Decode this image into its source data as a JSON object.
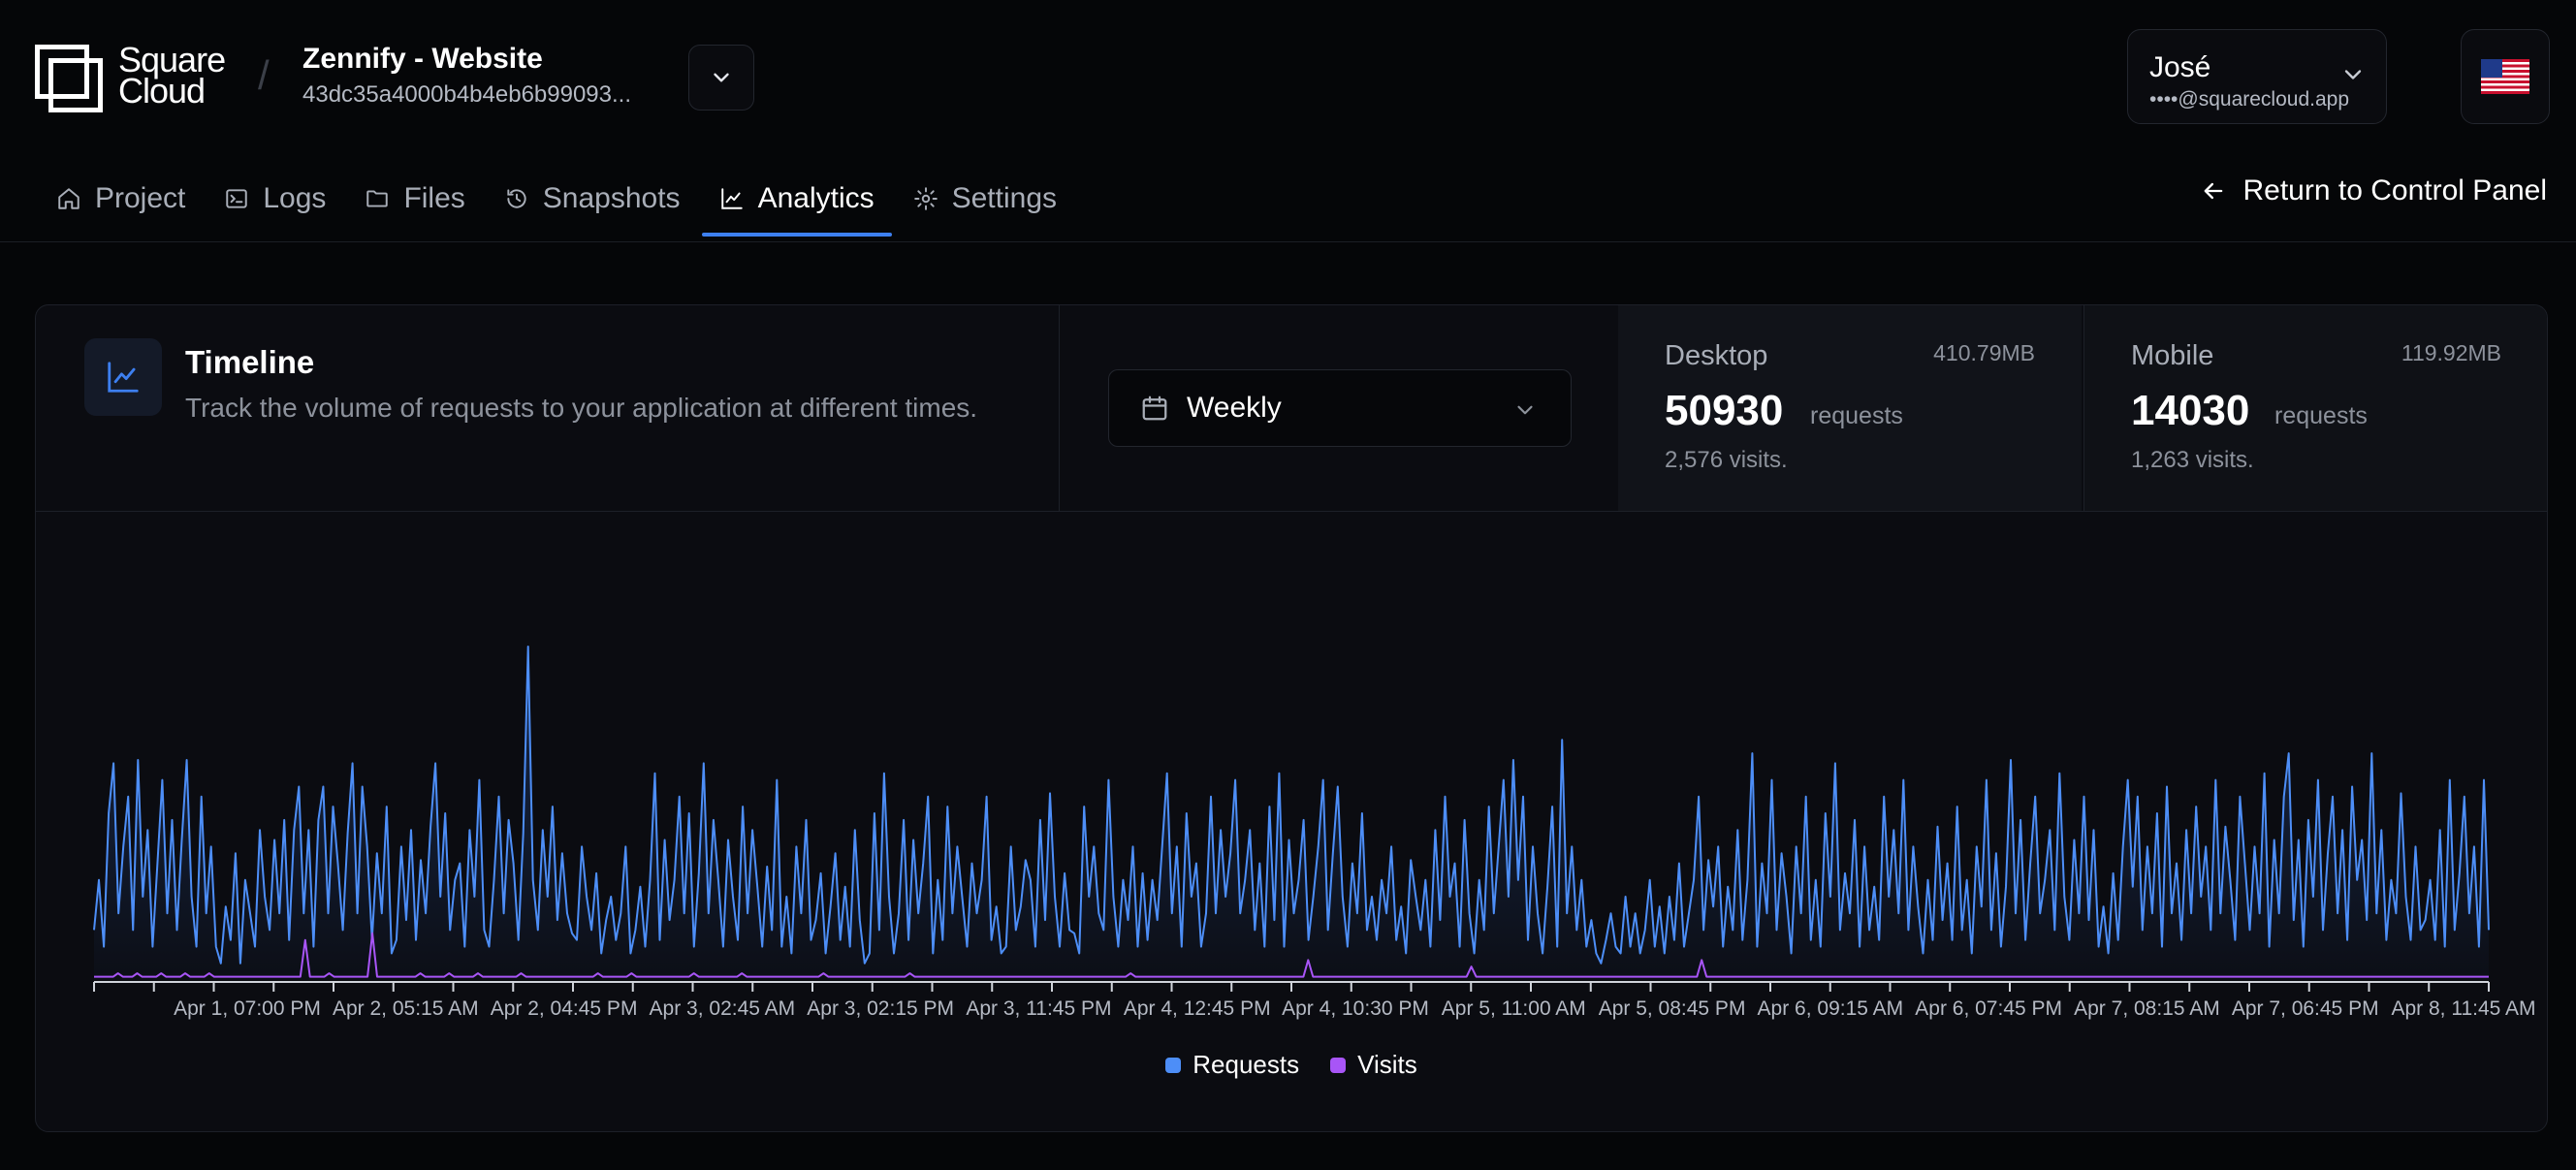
{
  "header": {
    "brand": {
      "line1": "Square",
      "line2": "Cloud"
    },
    "project": {
      "name": "Zennify - Website",
      "id": "43dc35a4000b4b4eb6b99093..."
    },
    "user": {
      "name": "José",
      "email": "••••@squarecloud.app"
    },
    "flag_icon": "us-flag-icon"
  },
  "tabs": [
    {
      "label": "Project",
      "icon": "home-icon",
      "active": false
    },
    {
      "label": "Logs",
      "icon": "terminal-icon",
      "active": false
    },
    {
      "label": "Files",
      "icon": "folder-icon",
      "active": false
    },
    {
      "label": "Snapshots",
      "icon": "history-icon",
      "active": false
    },
    {
      "label": "Analytics",
      "icon": "chart-line-icon",
      "active": true
    },
    {
      "label": "Settings",
      "icon": "gear-icon",
      "active": false
    }
  ],
  "return_label": "Return to Control Panel",
  "timeline": {
    "title": "Timeline",
    "description": "Track the volume of requests to your application at different times.",
    "period": "Weekly"
  },
  "stats": {
    "desktop": {
      "label": "Desktop",
      "size": "410.79MB",
      "requests": "50930",
      "unit": "requests",
      "visits": "2,576 visits."
    },
    "mobile": {
      "label": "Mobile",
      "size": "119.92MB",
      "requests": "14030",
      "unit": "requests",
      "visits": "1,263 visits."
    }
  },
  "colors": {
    "accent": "#3d7ff0",
    "requests": "#4d8ef7",
    "visits": "#a855f7"
  },
  "chart_data": {
    "type": "line",
    "x_tick_labels": [
      "Apr 1, 07:00 PM",
      "Apr 2, 05:15 AM",
      "Apr 2, 04:45 PM",
      "Apr 3, 02:45 AM",
      "Apr 3, 02:15 PM",
      "Apr 3, 11:45 PM",
      "Apr 4, 12:45 PM",
      "Apr 4, 10:30 PM",
      "Apr 5, 11:00 AM",
      "Apr 5, 08:45 PM",
      "Apr 6, 09:15 AM",
      "Apr 6, 07:45 PM",
      "Apr 7, 08:15 AM",
      "Apr 7, 06:45 PM",
      "Apr 8, 11:45 AM"
    ],
    "ylim": [
      0,
      100
    ],
    "grid": false,
    "legend": "bottom-center",
    "series": [
      {
        "name": "Requests",
        "values": [
          15,
          30,
          10,
          50,
          65,
          20,
          40,
          55,
          15,
          66,
          25,
          45,
          10,
          35,
          60,
          20,
          48,
          15,
          42,
          66,
          25,
          10,
          55,
          20,
          40,
          10,
          5,
          22,
          12,
          38,
          5,
          30,
          20,
          10,
          45,
          25,
          15,
          42,
          20,
          48,
          12,
          45,
          58,
          20,
          45,
          10,
          48,
          58,
          20,
          52,
          35,
          15,
          44,
          65,
          20,
          58,
          40,
          12,
          38,
          20,
          52,
          8,
          12,
          40,
          18,
          45,
          12,
          36,
          20,
          46,
          65,
          25,
          50,
          15,
          30,
          35,
          10,
          45,
          25,
          60,
          15,
          10,
          30,
          55,
          20,
          48,
          35,
          12,
          44,
          100,
          30,
          15,
          45,
          25,
          52,
          18,
          38,
          20,
          14,
          12,
          40,
          25,
          15,
          32,
          8,
          18,
          25,
          12,
          20,
          40,
          8,
          15,
          28,
          10,
          30,
          62,
          12,
          42,
          18,
          30,
          55,
          20,
          50,
          10,
          32,
          65,
          20,
          48,
          30,
          10,
          42,
          25,
          12,
          52,
          20,
          45,
          28,
          10,
          34,
          15,
          60,
          10,
          25,
          8,
          40,
          20,
          48,
          12,
          18,
          32,
          8,
          22,
          38,
          12,
          28,
          10,
          45,
          18,
          5,
          8,
          50,
          15,
          62,
          25,
          8,
          20,
          48,
          12,
          42,
          20,
          35,
          55,
          8,
          30,
          12,
          52,
          20,
          40,
          25,
          10,
          35,
          20,
          30,
          55,
          12,
          22,
          8,
          10,
          40,
          15,
          22,
          36,
          30,
          10,
          48,
          18,
          56,
          25,
          10,
          32,
          15,
          14,
          8,
          52,
          25,
          40,
          20,
          15,
          60,
          25,
          10,
          30,
          18,
          40,
          10,
          32,
          12,
          30,
          18,
          40,
          62,
          20,
          40,
          10,
          50,
          25,
          35,
          10,
          20,
          55,
          20,
          45,
          25,
          38,
          60,
          20,
          30,
          45,
          15,
          35,
          10,
          52,
          18,
          62,
          10,
          42,
          20,
          30,
          48,
          12,
          25,
          40,
          60,
          15,
          38,
          58,
          25,
          10,
          35,
          20,
          50,
          15,
          25,
          12,
          30,
          20,
          40,
          12,
          22,
          8,
          36,
          25,
          15,
          30,
          10,
          45,
          18,
          55,
          25,
          35,
          10,
          48,
          20,
          8,
          30,
          15,
          52,
          20,
          40,
          60,
          25,
          66,
          30,
          55,
          12,
          40,
          20,
          8,
          28,
          52,
          10,
          72,
          20,
          40,
          15,
          30,
          10,
          18,
          8,
          5,
          12,
          20,
          10,
          8,
          25,
          10,
          20,
          8,
          15,
          30,
          10,
          22,
          8,
          25,
          12,
          35,
          10,
          20,
          30,
          55,
          15,
          36,
          22,
          40,
          10,
          28,
          15,
          45,
          12,
          30,
          68,
          10,
          35,
          20,
          60,
          15,
          38,
          25,
          8,
          40,
          20,
          55,
          12,
          30,
          10,
          50,
          25,
          65,
          15,
          32,
          20,
          48,
          10,
          40,
          15,
          28,
          12,
          55,
          25,
          45,
          20,
          60,
          15,
          40,
          22,
          8,
          30,
          12,
          46,
          18,
          35,
          12,
          52,
          15,
          30,
          8,
          40,
          22,
          60,
          15,
          38,
          10,
          28,
          66,
          20,
          48,
          12,
          35,
          55,
          20,
          30,
          45,
          15,
          62,
          25,
          12,
          42,
          20,
          55,
          18,
          45,
          10,
          22,
          8,
          32,
          12,
          40,
          60,
          28,
          55,
          15,
          40,
          20,
          50,
          10,
          58,
          20,
          35,
          12,
          45,
          20,
          52,
          25,
          40,
          15,
          60,
          20,
          46,
          30,
          12,
          55,
          35,
          15,
          40,
          20,
          62,
          10,
          42,
          20,
          55,
          68,
          18,
          42,
          10,
          48,
          25,
          60,
          15,
          38,
          55,
          20,
          45,
          12,
          58,
          30,
          42,
          18,
          68,
          20,
          45,
          12,
          30,
          20,
          56,
          25,
          12,
          40,
          15,
          18,
          30,
          12,
          45,
          10,
          60,
          15,
          32,
          55,
          20,
          40,
          10,
          60,
          15
        ],
        "_unused": null
      },
      {
        "name": "Visits",
        "values": [
          1,
          1,
          1,
          1,
          1,
          2,
          1,
          1,
          1,
          2,
          1,
          1,
          1,
          1,
          2,
          1,
          1,
          1,
          1,
          2,
          1,
          1,
          1,
          1,
          2,
          1,
          1,
          1,
          1,
          1,
          1,
          1,
          1,
          1,
          1,
          1,
          1,
          1,
          1,
          1,
          1,
          1,
          1,
          1,
          12,
          1,
          1,
          1,
          1,
          2,
          1,
          1,
          1,
          1,
          1,
          1,
          1,
          1,
          14,
          1,
          1,
          1,
          1,
          1,
          1,
          1,
          1,
          1,
          2,
          1,
          1,
          1,
          1,
          1,
          2,
          1,
          1,
          1,
          1,
          1,
          2,
          1,
          1,
          1,
          1,
          1,
          1,
          1,
          1,
          2,
          1,
          1,
          1,
          1,
          1,
          1,
          1,
          1,
          1,
          1,
          1,
          1,
          1,
          1,
          1,
          2,
          1,
          1,
          1,
          1,
          1,
          1,
          2,
          1,
          1,
          1,
          1,
          1,
          1,
          1,
          1,
          1,
          1,
          1,
          1,
          2,
          1,
          1,
          1,
          1,
          1,
          1,
          1,
          1,
          1,
          2,
          1,
          1,
          1,
          1,
          1,
          1,
          1,
          1,
          1,
          1,
          1,
          1,
          1,
          1,
          1,
          1,
          2,
          1,
          1,
          1,
          1,
          1,
          1,
          1,
          1,
          1,
          1,
          1,
          1,
          1,
          1,
          1,
          1,
          1,
          2,
          1,
          1,
          1,
          1,
          1,
          1,
          1,
          1,
          1,
          1,
          1,
          1,
          1,
          1,
          1,
          1,
          1,
          1,
          1,
          1,
          1,
          1,
          1,
          1,
          1,
          1,
          1,
          1,
          1,
          1,
          1,
          1,
          1,
          1,
          1,
          1,
          1,
          1,
          1,
          1,
          1,
          1,
          1,
          1,
          1,
          2,
          1,
          1,
          1,
          1,
          1,
          1,
          1,
          1,
          1,
          1,
          1,
          1,
          1,
          1,
          1,
          1,
          1,
          1,
          1,
          1,
          1,
          1,
          1,
          1,
          1,
          1,
          1,
          1,
          1,
          1,
          1,
          1,
          1,
          1,
          1,
          1,
          6,
          1,
          1,
          1,
          1,
          1,
          1,
          1,
          1,
          1,
          1,
          1,
          1,
          1,
          1,
          1,
          1,
          1,
          1,
          1,
          1,
          1,
          1,
          1,
          1,
          1,
          1,
          1,
          1,
          1,
          1,
          1,
          1,
          1,
          4,
          1,
          1,
          1,
          1,
          1,
          1,
          1,
          1,
          1,
          1,
          1,
          1,
          1,
          1,
          1,
          1,
          1,
          1,
          1,
          1,
          1,
          1,
          1,
          1,
          1,
          1,
          1,
          1,
          1,
          1,
          1,
          1,
          1,
          1,
          1,
          1,
          1,
          1,
          1,
          1,
          1,
          1,
          1,
          1,
          1,
          1,
          1,
          6,
          1,
          1,
          1,
          1,
          1,
          1,
          1,
          1,
          1,
          1,
          1,
          1,
          1,
          1,
          1,
          1,
          1,
          1,
          1,
          1,
          1,
          1,
          1,
          1,
          1,
          1,
          1,
          1,
          1,
          1,
          1,
          1,
          1,
          1,
          1,
          1,
          1,
          1,
          1,
          1,
          1,
          1,
          1,
          1,
          1,
          1,
          1,
          1,
          1,
          1,
          1,
          1,
          1,
          1,
          1,
          1,
          1,
          1,
          1,
          1,
          1,
          1,
          1,
          1,
          1,
          1,
          1,
          1,
          1,
          1,
          1,
          1,
          1,
          1,
          1,
          1,
          1,
          1,
          1,
          1,
          1,
          1,
          1,
          1,
          1,
          1,
          1,
          1,
          1,
          1,
          1,
          1,
          1,
          1,
          1,
          1,
          1,
          1,
          1,
          1,
          1,
          1,
          1,
          1,
          1,
          1,
          1,
          1,
          1,
          1,
          1,
          1,
          1,
          1,
          1,
          1,
          1,
          1,
          1,
          1,
          1,
          1,
          1,
          1,
          1,
          1,
          1,
          1,
          1,
          1,
          1,
          1,
          1,
          1,
          1,
          1,
          1,
          1,
          1,
          1,
          1,
          1,
          1,
          1,
          1,
          1,
          1,
          1,
          1,
          1,
          1,
          1,
          1,
          1,
          1,
          1,
          1,
          1,
          1,
          1,
          1,
          1,
          1,
          1
        ]
      }
    ]
  }
}
